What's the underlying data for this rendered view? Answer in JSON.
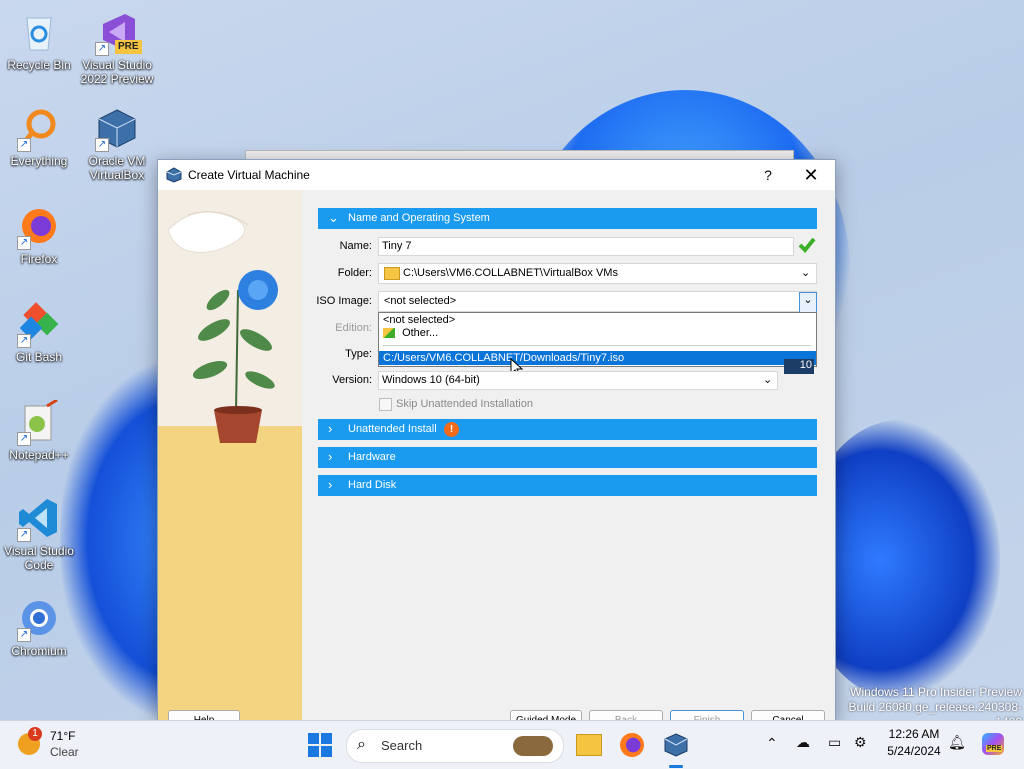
{
  "desktop": {
    "icons": [
      {
        "label": "Recycle Bin"
      },
      {
        "label": "Visual Studio 2022 Preview",
        "badge": "PRE"
      },
      {
        "label": "Everything"
      },
      {
        "label": "Oracle VM VirtualBox"
      },
      {
        "label": "Firefox"
      },
      {
        "label": "Git Bash"
      },
      {
        "label": "Notepad++"
      },
      {
        "label": "Visual Studio Code"
      },
      {
        "label": "Chromium"
      }
    ],
    "watermark": {
      "line1": "Windows 11 Pro Insider Preview",
      "line2": "Build 26080.ge_release.240308-1400"
    }
  },
  "dialog": {
    "title": "Create Virtual Machine",
    "help": "?",
    "close": "✕",
    "sections": {
      "name_os": "Name and Operating System",
      "unattended": "Unattended Install",
      "hardware": "Hardware",
      "hard_disk": "Hard Disk"
    },
    "labels": {
      "name": "Name:",
      "folder": "Folder:",
      "iso": "ISO Image:",
      "edition": "Edition:",
      "type": "Type:",
      "version": "Version:"
    },
    "values": {
      "name": "Tiny 7",
      "folder": "C:\\Users\\VM6.COLLABNET\\VirtualBox VMs",
      "iso": "<not selected>",
      "version": "Windows 10 (64-bit)",
      "version_badge": "10"
    },
    "iso_options": [
      "<not selected>",
      "Other...",
      "C:/Users/VM6.COLLABNET/Downloads/Tiny7.iso"
    ],
    "skip_unattended": "Skip Unattended Installation",
    "buttons": {
      "help": "Help",
      "guided": "Guided Mode",
      "back": "Back",
      "finish": "Finish",
      "cancel": "Cancel"
    }
  },
  "taskbar": {
    "weather": {
      "temp": "71°F",
      "condition": "Clear",
      "badge": "1"
    },
    "search_placeholder": "Search",
    "clock": {
      "time": "12:26 AM",
      "date": "5/24/2024"
    },
    "copilot_badge": "PRE"
  },
  "colors": {
    "section_blue": "#1a9bf0",
    "selection_blue": "#0b74d8"
  }
}
